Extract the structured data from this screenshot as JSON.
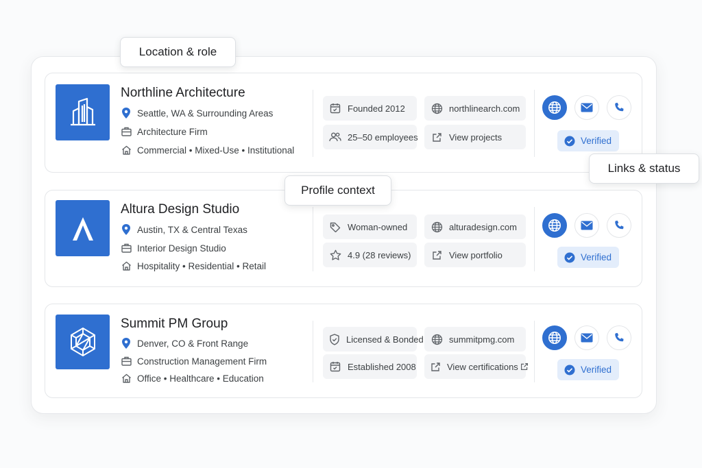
{
  "callouts": {
    "location_role": "Location & role",
    "profile_context": "Profile context",
    "links_status": "Links & status"
  },
  "colors": {
    "accent": "#2f6fd0",
    "verified_bg": "#e3edfb",
    "chip_bg": "#f3f4f6"
  },
  "firms": [
    {
      "name": "Northline Architecture",
      "logo_icon": "building-icon",
      "location": "Seattle, WA & Surrounding Areas",
      "role": "Architecture Firm",
      "sectors": "Commercial  •  Mixed-Use  •  Institutional",
      "chip1": "Founded 2012",
      "chip2": "25–50 employees",
      "website": "northlinearch.com",
      "link": "View projects",
      "status": "Verified"
    },
    {
      "name": "Altura Design Studio",
      "logo_icon": "chevron-a-icon",
      "location": "Austin, TX & Central Texas",
      "role": "Interior Design Studio",
      "sectors": "Hospitality  •  Residential  •  Retail",
      "chip1": "Woman-owned",
      "chip2": "4.9 (28 reviews)",
      "website": "alturadesign.com",
      "link": "View portfolio",
      "status": "Verified"
    },
    {
      "name": "Summit PM Group",
      "logo_icon": "hexagon-cube-icon",
      "location": "Denver, CO & Front Range",
      "role": "Construction Management Firm",
      "sectors": "Office  •  Healthcare  •  Education",
      "chip1": "Licensed & Bonded",
      "chip2": "Established 2008",
      "website": "summitpmg.com",
      "link": "View certifications",
      "status": "Verified"
    }
  ]
}
